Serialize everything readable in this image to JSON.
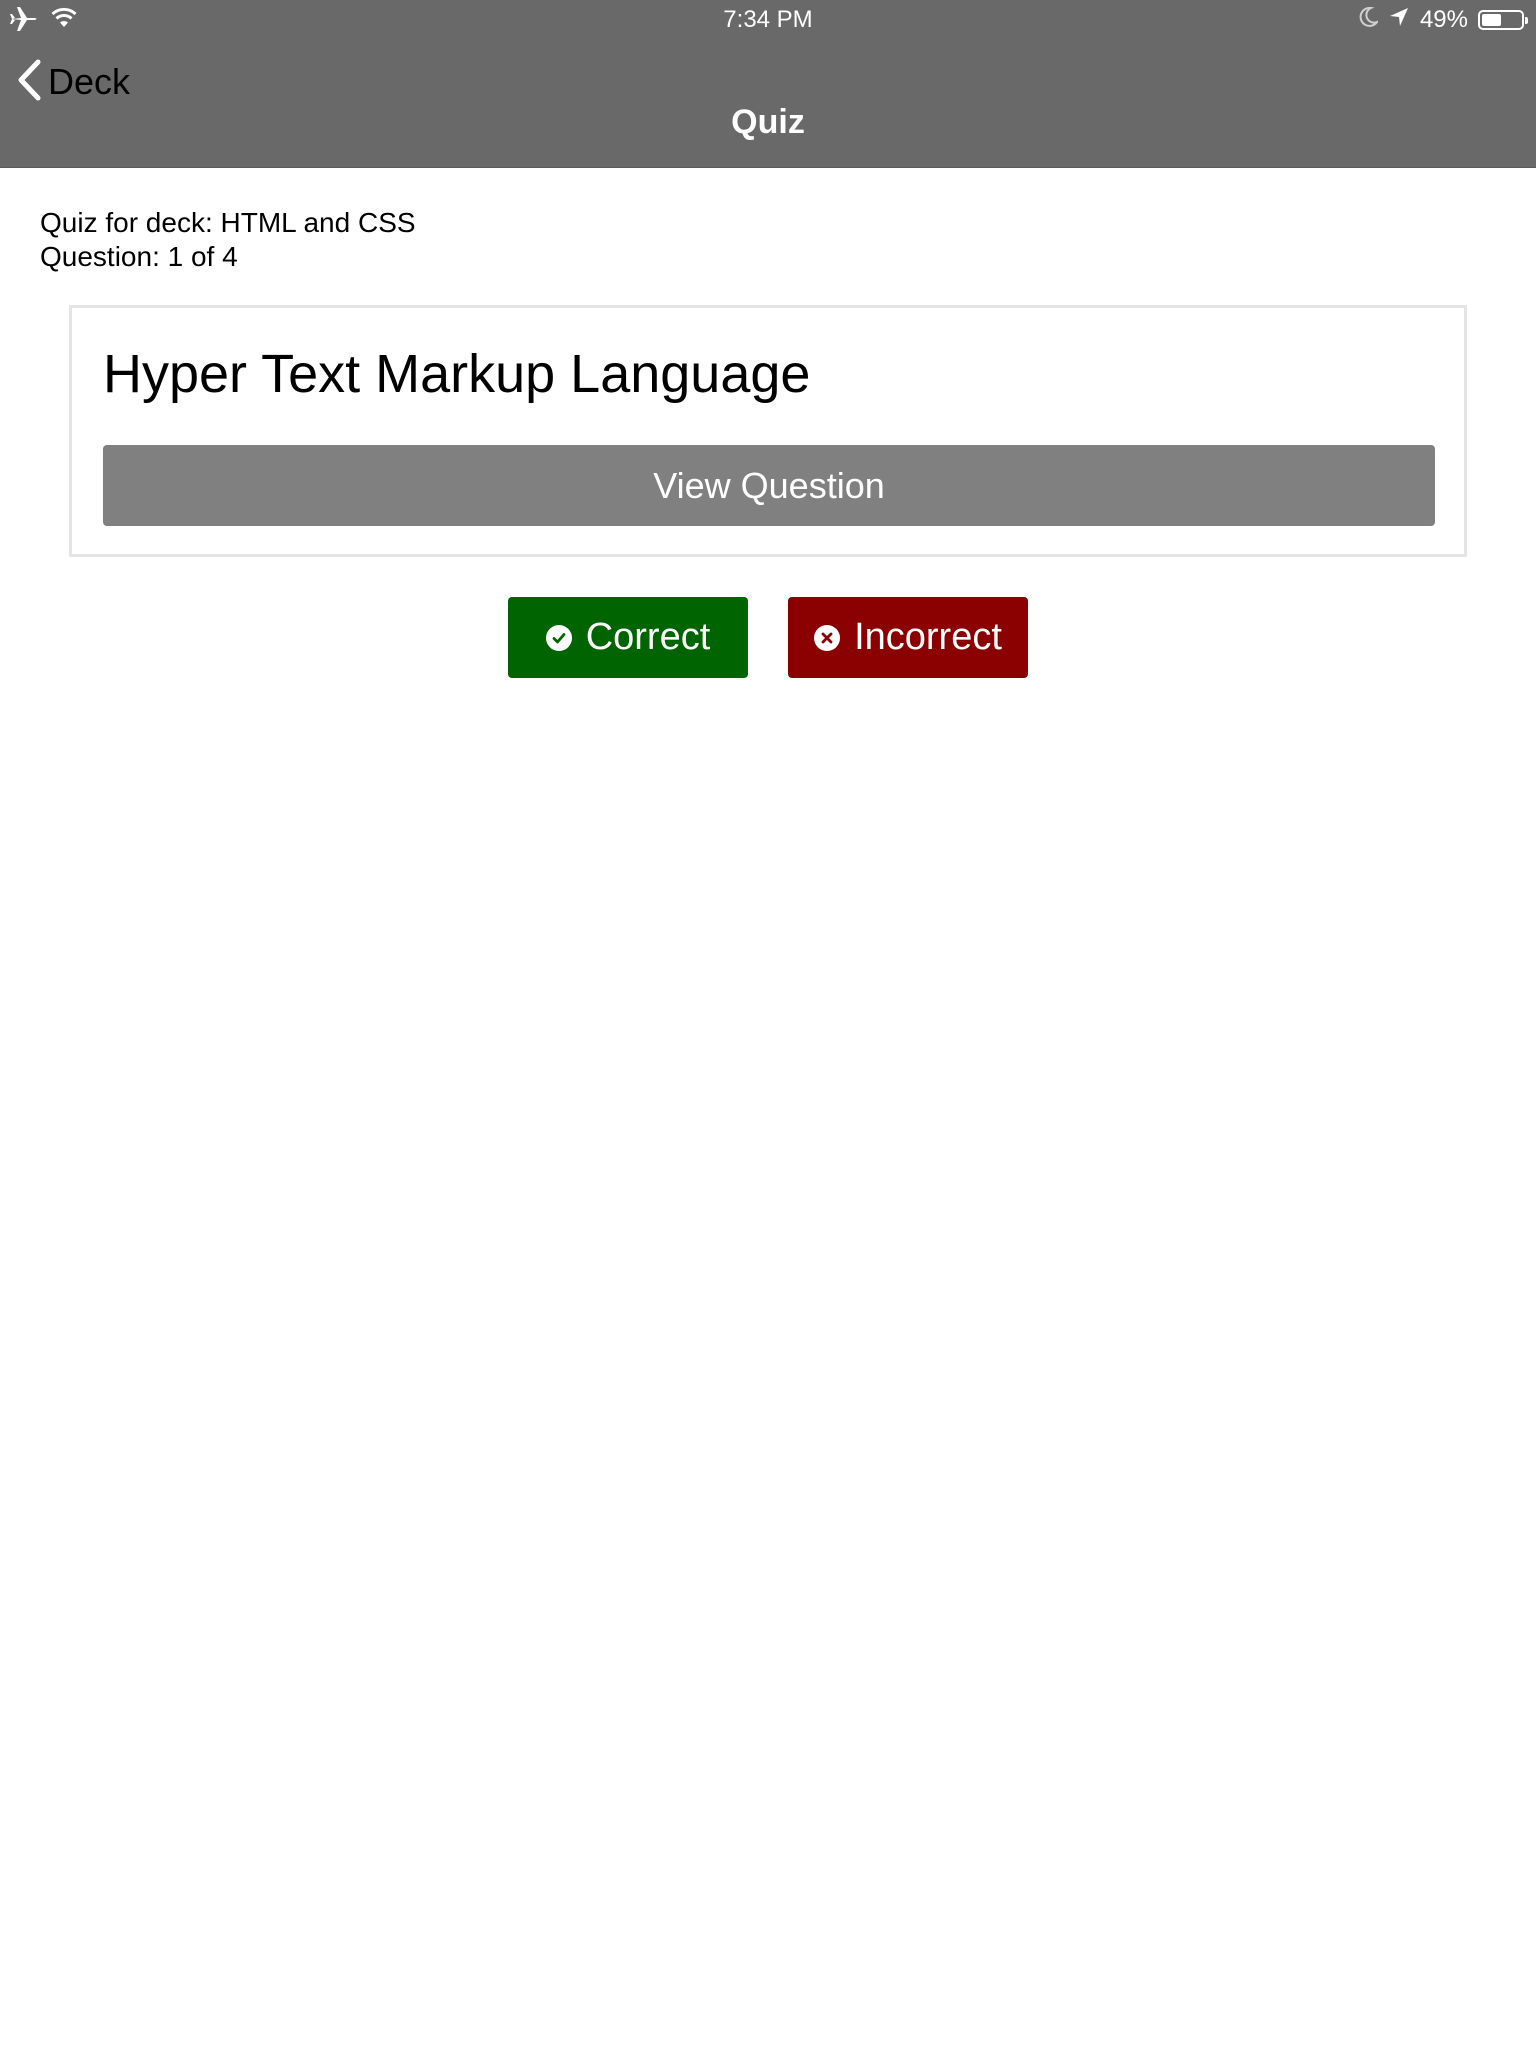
{
  "status_bar": {
    "time": "7:34 PM",
    "battery_percent": "49%",
    "battery_level": 0.49,
    "icons": [
      "airplane-icon",
      "wifi-icon",
      "moon-icon",
      "location-arrow-icon",
      "battery-icon"
    ]
  },
  "nav": {
    "back_label": "Deck",
    "title": "Quiz"
  },
  "quiz": {
    "deck_line": "Quiz for deck: HTML and CSS",
    "progress_line": "Question: 1 of 4"
  },
  "card": {
    "answer": "Hyper Text Markup Language",
    "view_button": "View Question"
  },
  "actions": {
    "correct_label": "Correct",
    "incorrect_label": "Incorrect"
  },
  "colors": {
    "header_bg": "#696969",
    "view_button_bg": "#808080",
    "correct_bg": "#006400",
    "incorrect_bg": "#8b0000"
  }
}
